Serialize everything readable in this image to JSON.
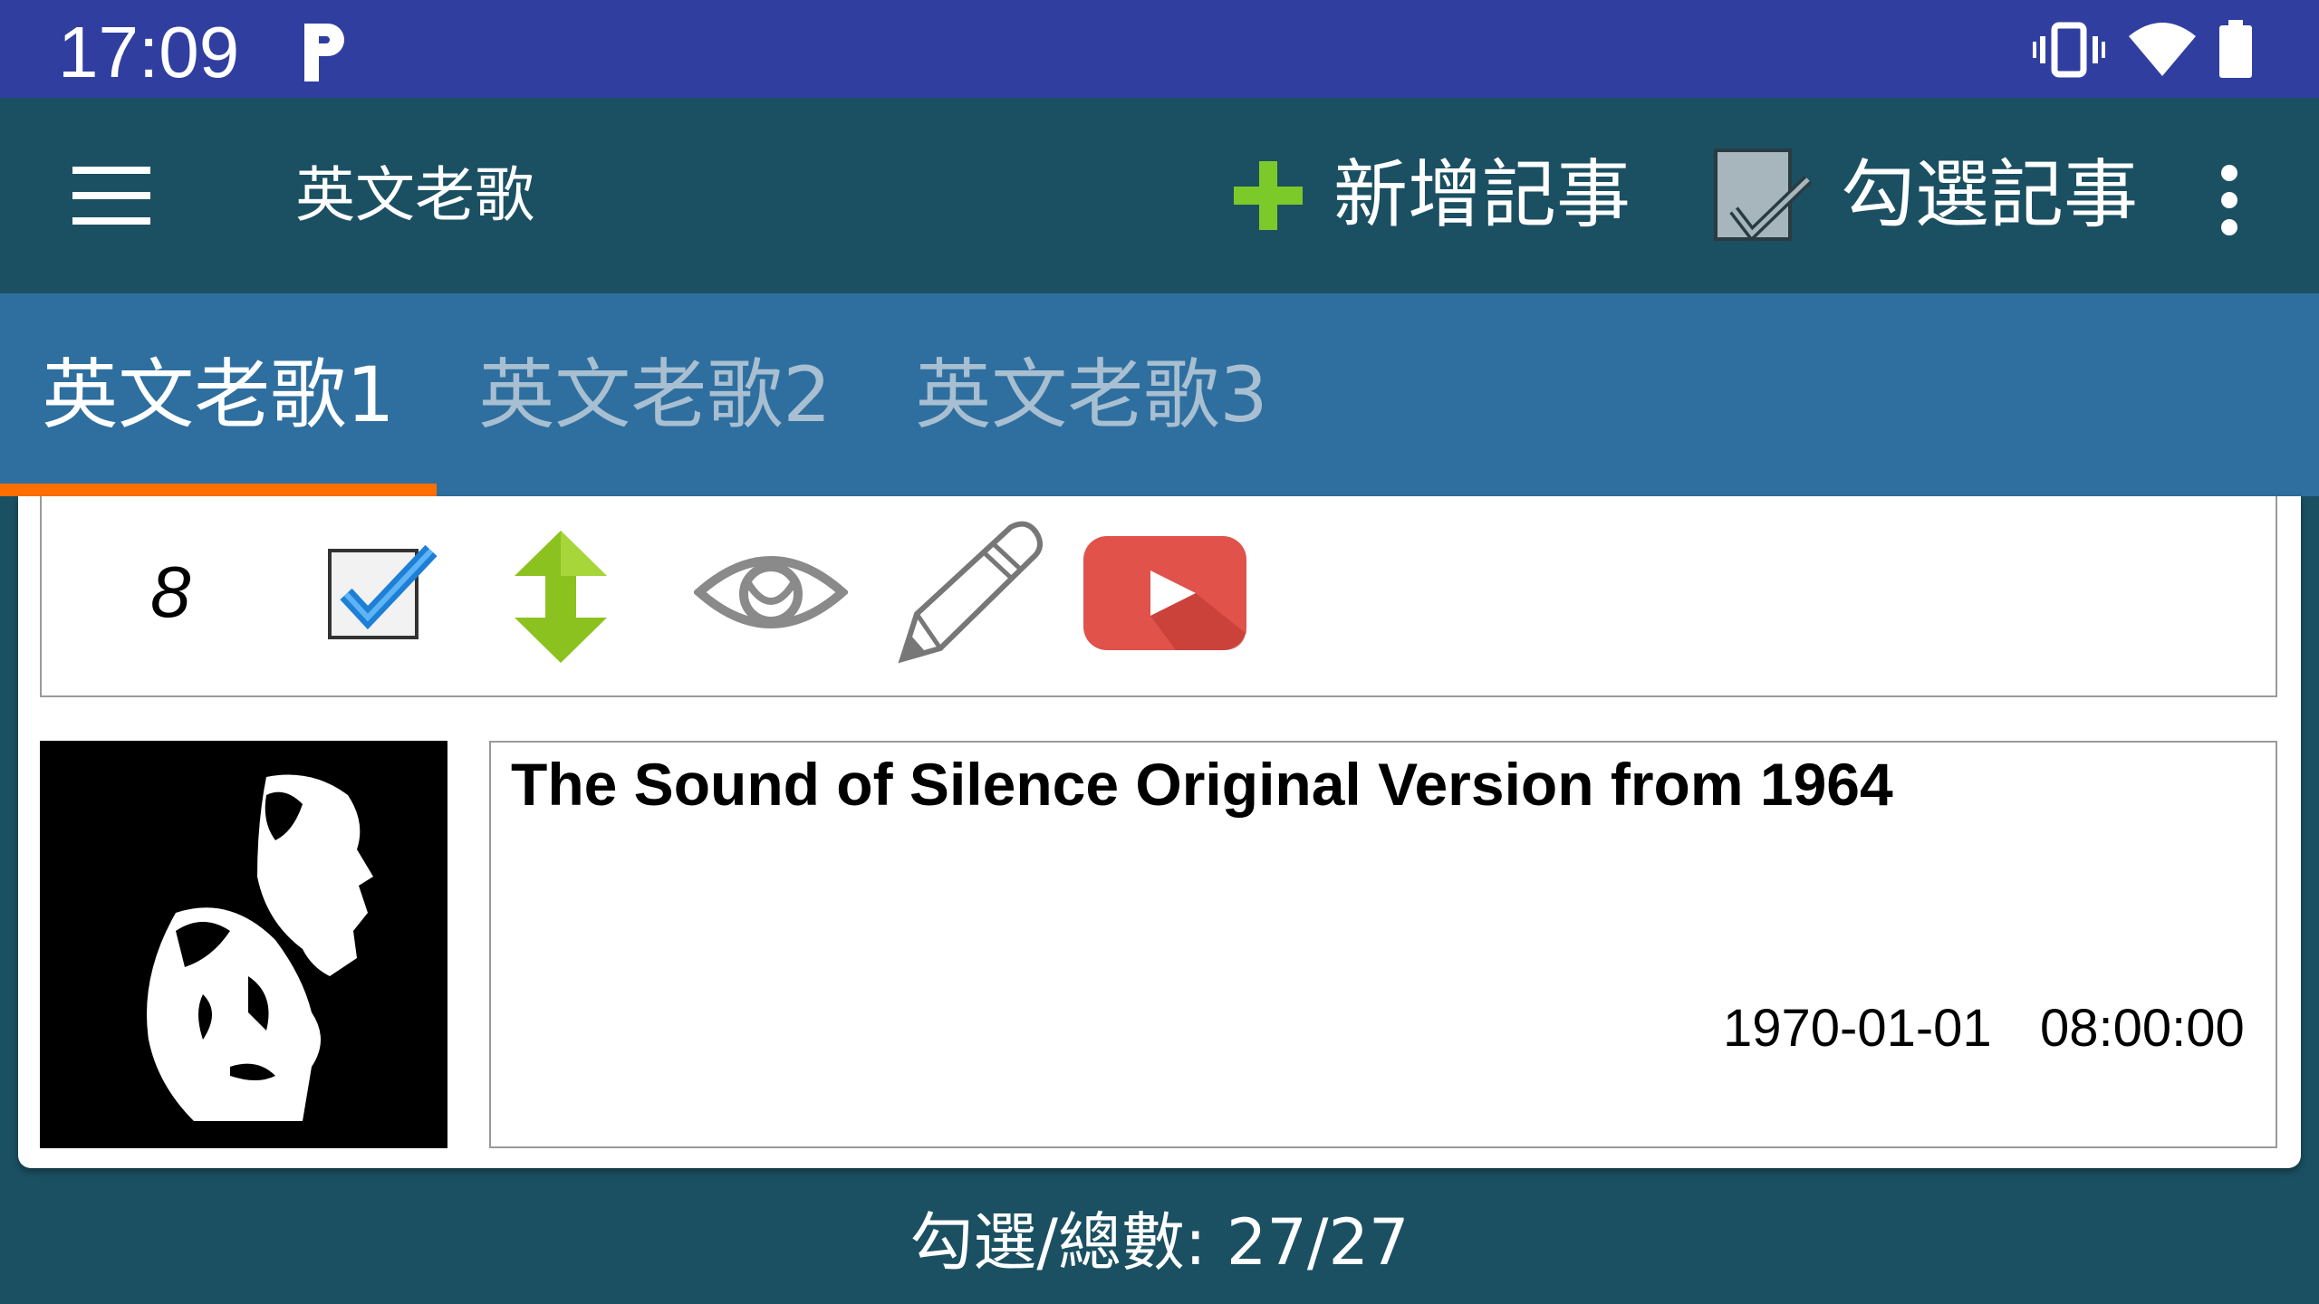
{
  "status_bar": {
    "time": "17:09",
    "icons": [
      "parking-icon",
      "vibrate-icon",
      "wifi-icon",
      "battery-icon"
    ]
  },
  "app_bar": {
    "menu_icon": "hamburger-menu-icon",
    "title": "英文老歌",
    "add_label": "新增記事",
    "add_icon": "plus-icon",
    "check_label": "勾選記事",
    "check_icon": "checkbox-icon",
    "overflow_icon": "more-vert-icon"
  },
  "tabs": [
    {
      "label": "英文老歌1",
      "active": true
    },
    {
      "label": "英文老歌2",
      "active": false
    },
    {
      "label": "英文老歌3",
      "active": false
    }
  ],
  "item": {
    "number": "8",
    "checked": true,
    "tools": [
      "checked-checkbox-icon",
      "move-updown-icon",
      "eye-icon",
      "pencil-icon",
      "youtube-play-icon"
    ],
    "title": "The Sound of Silence Original Version from 1964",
    "date": "1970-01-01",
    "time": "08:00:00"
  },
  "footer": {
    "text": "勾選/總數: 27/27"
  },
  "colors": {
    "status_bar": "#303f9f",
    "app_bar": "#1b5062",
    "tab_bar": "#2e6f9f",
    "tab_indicator": "#ff6f00",
    "plus_green": "#7cc92a",
    "youtube_red": "#e0524a"
  }
}
